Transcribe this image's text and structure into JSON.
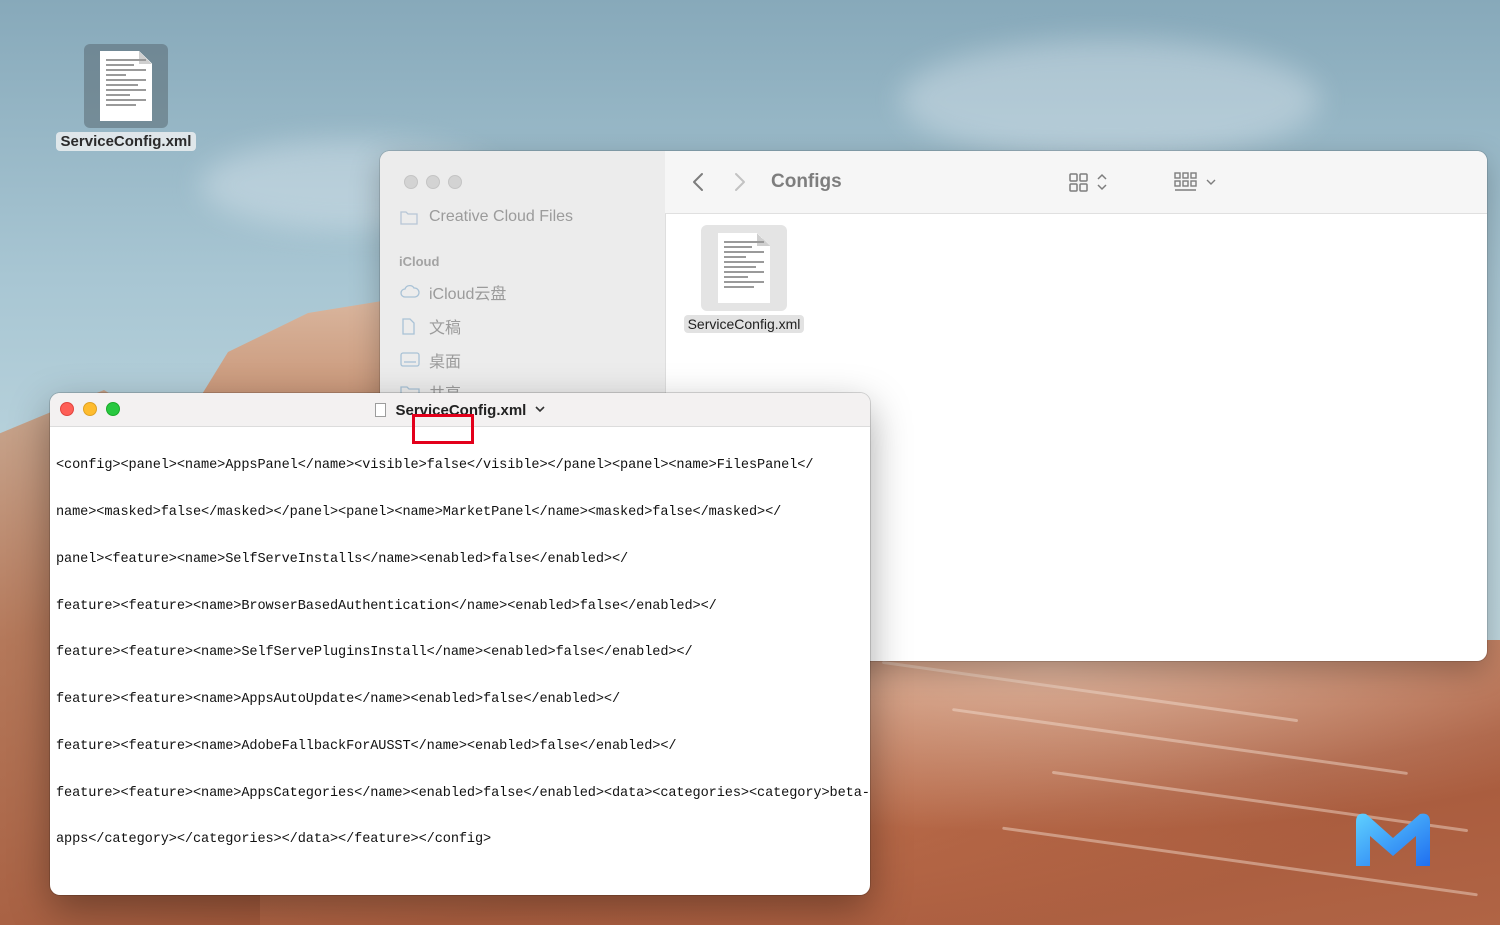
{
  "desktop": {
    "file_icon_label": "ServiceConfig.xml"
  },
  "finder": {
    "title": "Configs",
    "sidebar": {
      "partial_item": "Creative Cloud Files",
      "section_icloud": "iCloud",
      "items": [
        {
          "label": "iCloud云盘",
          "icon": "cloud-icon"
        },
        {
          "label": "文稿",
          "icon": "document-icon"
        },
        {
          "label": "桌面",
          "icon": "desktop-icon"
        },
        {
          "label": "共享",
          "icon": "shared-folder-icon"
        }
      ]
    },
    "toolbar_icons": [
      "back-icon",
      "forward-icon",
      "grid-view-icon",
      "group-icon",
      "share-icon",
      "tag-icon",
      "more-icon",
      "search-icon"
    ],
    "files": [
      {
        "name": "ServiceConfig.xml"
      }
    ]
  },
  "editor": {
    "title": "ServiceConfig.xml",
    "content_lines": [
      "<config><panel><name>AppsPanel</name><visible>false</visible></panel><panel><name>FilesPanel</",
      "name><masked>false</masked></panel><panel><name>MarketPanel</name><masked>false</masked></",
      "panel><feature><name>SelfServeInstalls</name><enabled>false</enabled></",
      "feature><feature><name>BrowserBasedAuthentication</name><enabled>false</enabled></",
      "feature><feature><name>SelfServePluginsInstall</name><enabled>false</enabled></",
      "feature><feature><name>AppsAutoUpdate</name><enabled>false</enabled></",
      "feature><feature><name>AdobeFallbackForAUSST</name><enabled>false</enabled></",
      "feature><feature><name>AppsCategories</name><enabled>false</enabled><data><categories><category>beta-",
      "apps</category></categories></data></feature></config>"
    ],
    "highlight_color": "#e3001b"
  },
  "colors": {
    "close": "#fe5f57",
    "minimize": "#febc2e",
    "maximize": "#28c840"
  }
}
